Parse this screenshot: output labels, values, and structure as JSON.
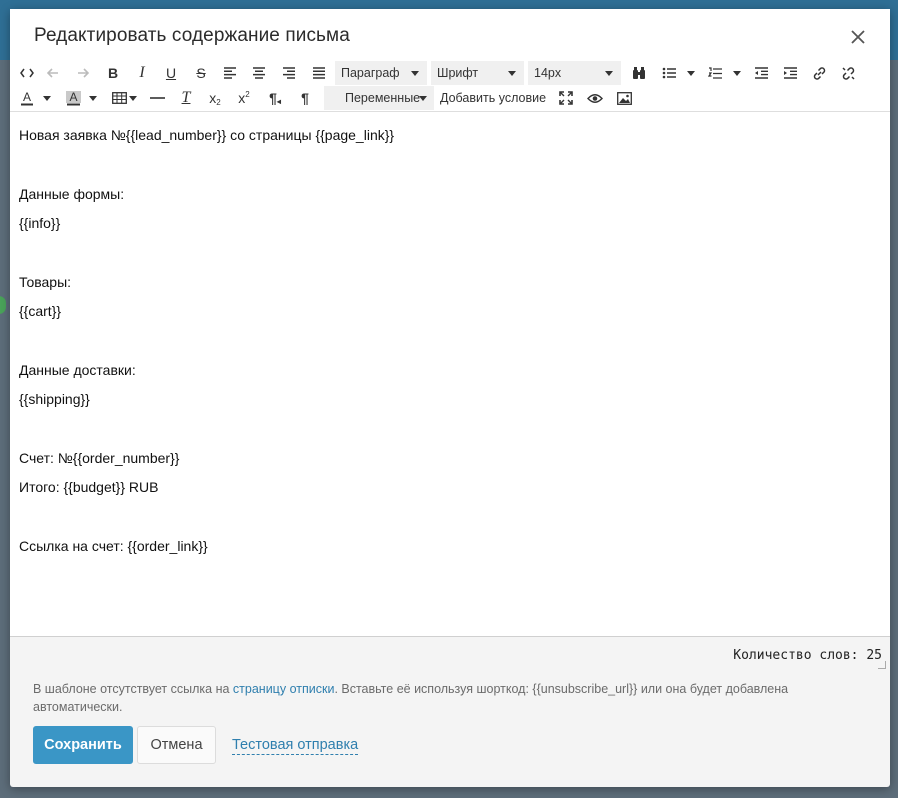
{
  "dialog": {
    "title": "Редактировать содержание письма",
    "close_icon": "close-icon"
  },
  "toolbar": {
    "paragraph_select": "Параграф",
    "font_select": "Шрифт",
    "size_select": "14px",
    "variables_button": "Переменные",
    "add_condition_button": "Добавить условие",
    "icons": {
      "source_code": "<>",
      "bold": "B",
      "italic": "I",
      "underline": "U",
      "strike": "S",
      "clear_format": "T",
      "subscript": "x",
      "superscript": "x",
      "paragraph": "¶"
    }
  },
  "editor": {
    "lines": [
      "Новая заявка №{{lead_number}} со страницы {{page_link}}",
      "Данные формы:",
      "{{info}}",
      "Товары:",
      "{{cart}}",
      "Данные доставки:",
      "{{shipping}}",
      "Счет: №{{order_number}}",
      "Итого: {{budget}} RUB",
      "Ссылка на счет: {{order_link}}"
    ]
  },
  "status": {
    "word_count": "Количество слов: 25"
  },
  "notice": {
    "before_link": "В шаблоне отсутствует ссылка на ",
    "link_text": "страницу отписки",
    "after_link": ". Вставьте её используя шорткод: {{unsubscribe_url}} или она будет добавлена автоматически."
  },
  "footer": {
    "save_label": "Сохранить",
    "cancel_label": "Отмена",
    "test_send_label": "Тестовая отправка"
  },
  "colors": {
    "primary": "#3a96c6",
    "link": "#2f7fae"
  }
}
